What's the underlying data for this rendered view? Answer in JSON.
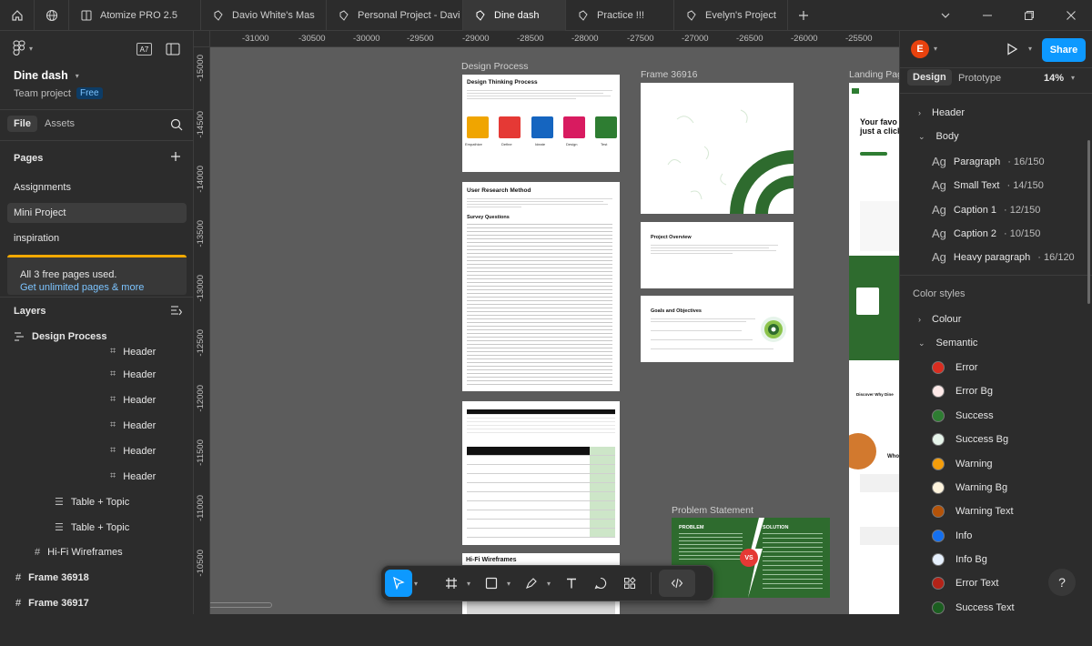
{
  "tabs": [
    {
      "label": "Atomize PRO 2.5"
    },
    {
      "label": "Davio White's Mas"
    },
    {
      "label": "Personal Project - Davi"
    },
    {
      "label": "Dine dash"
    },
    {
      "label": "Practice !!!"
    },
    {
      "label": "Evelyn's Project"
    }
  ],
  "file": {
    "name": "Dine dash",
    "team": "Team project",
    "plan": "Free"
  },
  "left_tabs": {
    "file": "File",
    "assets": "Assets"
  },
  "pages": {
    "title": "Pages",
    "items": [
      "Assignments",
      "Mini Project",
      "inspiration"
    ]
  },
  "upsell": {
    "text": "All 3 free pages used.",
    "link": "Get unlimited pages & more"
  },
  "layers": {
    "title": "Layers",
    "root": "Design Process",
    "children": [
      "Header",
      "Header",
      "Header",
      "Header",
      "Header",
      "Header"
    ],
    "tables": [
      "Table + Topic",
      "Table + Topic"
    ],
    "others": [
      "Hi-Fi Wireframes",
      "Frame 36918",
      "Frame 36917"
    ]
  },
  "ruler_top": [
    "-31000",
    "-30500",
    "-30000",
    "-29500",
    "-29000",
    "-28500",
    "-28000",
    "-27500",
    "-27000",
    "-26500",
    "-26000",
    "-25500"
  ],
  "ruler_left": [
    "-15000",
    "-14500",
    "-14000",
    "-13500",
    "-13000",
    "-12500",
    "-12000",
    "-11500",
    "-11000",
    "-10500"
  ],
  "canvas": {
    "design_process": "Design Process",
    "frame_36916": "Frame 36916",
    "landing": "Landing Pag",
    "problem_statement": "Problem Statement",
    "hifi": "Hi-Fi Wireframes",
    "dtp_title": "Design Thinking Process",
    "dtp_steps": [
      "Empathize",
      "Define",
      "Ideate",
      "Design",
      "Test"
    ],
    "urm_title": "User Research Method",
    "survey": "Survey Questions",
    "project_overview": "Project Overview",
    "goals": "Goals and Objectives",
    "problem": "PROBLEM",
    "solution": "SOLUTION",
    "vs": "VS",
    "hero_text": "Your favo just a click",
    "discover": "Discover Why Dine",
    "who": "Who"
  },
  "right_panel": {
    "avatar": "E",
    "share": "Share",
    "tab_design": "Design",
    "tab_prototype": "Prototype",
    "zoom": "14%",
    "header": "Header",
    "body": "Body",
    "text_styles": [
      {
        "name": "Paragraph",
        "meta": "16/150"
      },
      {
        "name": "Small Text",
        "meta": "14/150"
      },
      {
        "name": "Caption 1",
        "meta": "12/150"
      },
      {
        "name": "Caption 2",
        "meta": "10/150"
      },
      {
        "name": "Heavy paragraph",
        "meta": "16/120"
      }
    ],
    "ag": "Ag",
    "color_styles": "Color styles",
    "colour": "Colour",
    "semantic": "Semantic",
    "colors": [
      {
        "name": "Error",
        "hex": "#d92d20"
      },
      {
        "name": "Error Bg",
        "hex": "#fde9e8"
      },
      {
        "name": "Success",
        "hex": "#2e7d32"
      },
      {
        "name": "Success Bg",
        "hex": "#e6f4ea"
      },
      {
        "name": "Warning",
        "hex": "#f59e0b"
      },
      {
        "name": "Warning Bg",
        "hex": "#fdf3dc"
      },
      {
        "name": "Warning Text",
        "hex": "#b45309"
      },
      {
        "name": "Info",
        "hex": "#1570ef"
      },
      {
        "name": "Info Bg",
        "hex": "#e6f0fd"
      },
      {
        "name": "Error Text",
        "hex": "#b42318"
      },
      {
        "name": "Success Text",
        "hex": "#1b5e20"
      }
    ],
    "help": "?"
  }
}
